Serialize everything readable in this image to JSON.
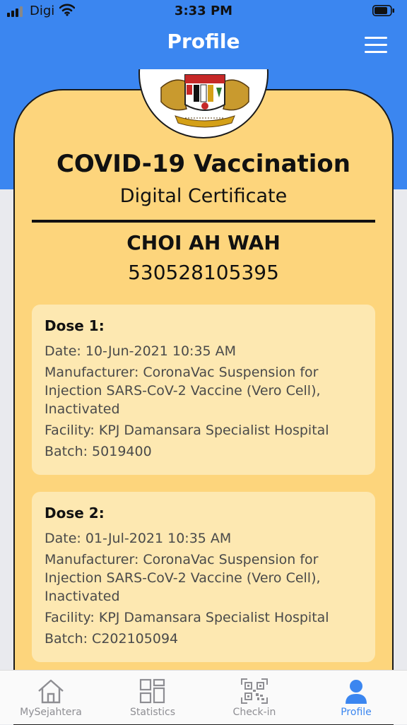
{
  "status_bar": {
    "carrier": "Digi",
    "time": "3:33 PM"
  },
  "header": {
    "title": "Profile",
    "menu_icon": "hamburger-menu-icon"
  },
  "certificate": {
    "emblem": "malaysia-coat-of-arms",
    "title": "COVID-19 Vaccination",
    "subtitle": "Digital Certificate",
    "holder_name": "CHOI AH WAH",
    "holder_id": "530528105395",
    "doses": [
      {
        "heading": "Dose 1:",
        "date": "Date: 10-Jun-2021 10:35 AM",
        "manufacturer": "Manufacturer: CoronaVac Suspension for Injection SARS-CoV-2 Vaccine (Vero Cell), Inactivated",
        "facility": "Facility: KPJ Damansara Specialist Hospital",
        "batch": "Batch: 5019400"
      },
      {
        "heading": "Dose 2:",
        "date": "Date: 01-Jul-2021 10:35 AM",
        "manufacturer": "Manufacturer: CoronaVac Suspension for Injection SARS-CoV-2 Vaccine (Vero Cell), Inactivated",
        "facility": "Facility: KPJ Damansara Specialist Hospital",
        "batch": "Batch: C202105094"
      }
    ]
  },
  "tab_bar": {
    "tabs": [
      {
        "label": "MySejahtera",
        "icon": "home-icon",
        "active": false
      },
      {
        "label": "Statistics",
        "icon": "statistics-grid-icon",
        "active": false
      },
      {
        "label": "Check-in",
        "icon": "qr-scan-icon",
        "active": false
      },
      {
        "label": "Profile",
        "icon": "person-icon",
        "active": true
      }
    ]
  },
  "colors": {
    "header_blue": "#3b86f0",
    "card_yellow": "#fdd57c",
    "dose_box": "#fde8b1",
    "tab_active": "#3b86f0",
    "tab_inactive": "#8e8e93"
  }
}
